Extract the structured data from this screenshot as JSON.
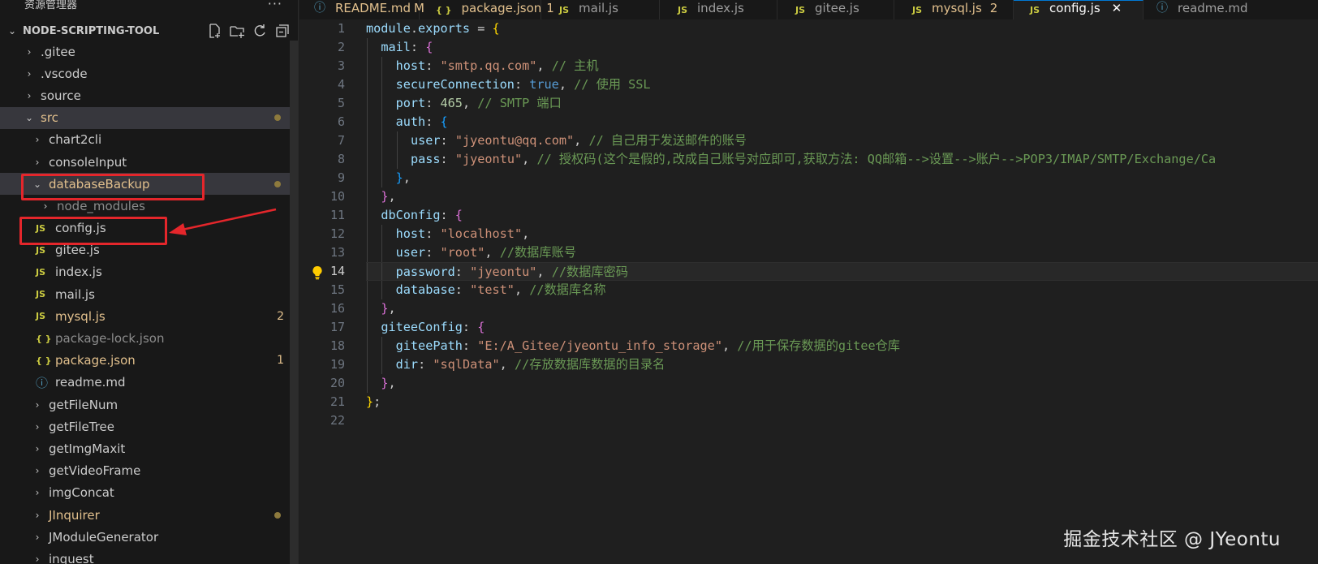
{
  "sidebar": {
    "title": "资源管理器",
    "more": "···",
    "project": "NODE-SCRIPTING-TOOL",
    "items": [
      {
        "label": ".gitee",
        "kind": "folder",
        "depth": 0
      },
      {
        "label": ".vscode",
        "kind": "folder",
        "depth": 0
      },
      {
        "label": "source",
        "kind": "folder",
        "depth": 0
      },
      {
        "label": "src",
        "kind": "folder-open",
        "depth": 0,
        "modified": true
      },
      {
        "label": "chart2cli",
        "kind": "folder",
        "depth": 1
      },
      {
        "label": "consoleInput",
        "kind": "folder",
        "depth": 1
      },
      {
        "label": "databaseBackup",
        "kind": "folder-open",
        "depth": 1,
        "modified": true
      },
      {
        "label": "node_modules",
        "kind": "folder",
        "depth": 2,
        "dim": true
      },
      {
        "label": "config.js",
        "kind": "js",
        "depth": 2
      },
      {
        "label": "gitee.js",
        "kind": "js",
        "depth": 2
      },
      {
        "label": "index.js",
        "kind": "js",
        "depth": 2
      },
      {
        "label": "mail.js",
        "kind": "js",
        "depth": 2
      },
      {
        "label": "mysql.js",
        "kind": "js",
        "depth": 2,
        "badge": "2"
      },
      {
        "label": "package-lock.json",
        "kind": "json",
        "depth": 2,
        "dim": true
      },
      {
        "label": "package.json",
        "kind": "json",
        "depth": 2,
        "badge": "1"
      },
      {
        "label": "readme.md",
        "kind": "info",
        "depth": 2
      },
      {
        "label": "getFileNum",
        "kind": "folder",
        "depth": 1
      },
      {
        "label": "getFileTree",
        "kind": "folder",
        "depth": 1
      },
      {
        "label": "getImgMaxit",
        "kind": "folder",
        "depth": 1
      },
      {
        "label": "getVideoFrame",
        "kind": "folder",
        "depth": 1
      },
      {
        "label": "imgConcat",
        "kind": "folder",
        "depth": 1
      },
      {
        "label": "JInquirer",
        "kind": "folder",
        "depth": 1,
        "modified": true
      },
      {
        "label": "JModuleGenerator",
        "kind": "folder",
        "depth": 1
      },
      {
        "label": "inquest",
        "kind": "folder",
        "depth": 1
      }
    ]
  },
  "tabs": [
    {
      "label": "README.md",
      "suffix": "M",
      "icon": "info"
    },
    {
      "label": "package.json",
      "suffix": "1",
      "icon": "json"
    },
    {
      "label": "mail.js",
      "suffix": "",
      "icon": "js"
    },
    {
      "label": "index.js",
      "suffix": "",
      "icon": "js"
    },
    {
      "label": "gitee.js",
      "suffix": "",
      "icon": "js"
    },
    {
      "label": "mysql.js",
      "suffix": "2",
      "icon": "js"
    },
    {
      "label": "config.js",
      "suffix": "",
      "icon": "js",
      "active": true
    },
    {
      "label": "readme.md",
      "suffix": "",
      "icon": "info"
    }
  ],
  "icons": {
    "js": "JS",
    "json": "{ }",
    "info": "ⓘ",
    "close": "✕"
  },
  "editor": {
    "current_line": 14,
    "lines": [
      "module.exports = {",
      "  mail: {",
      "    host: \"smtp.qq.com\", // 主机",
      "    secureConnection: true, // 使用 SSL",
      "    port: 465, // SMTP 端口",
      "    auth: {",
      "      user: \"jyeontu@qq.com\", // 自己用于发送邮件的账号",
      "      pass: \"jyeontu\", // 授权码(这个是假的,改成自己账号对应即可,获取方法: QQ邮箱-->设置-->账户-->POP3/IMAP/SMTP/Exchange/Ca",
      "    },",
      "  },",
      "  dbConfig: {",
      "    host: \"localhost\",",
      "    user: \"root\", //数据库账号",
      "    password: \"jyeontu\", //数据库密码",
      "    database: \"test\", //数据库名称",
      "  },",
      "  giteeConfig: {",
      "    giteePath: \"E:/A_Gitee/jyeontu_info_storage\", //用于保存数据的gitee仓库",
      "    dir: \"sqlData\", //存放数据库数据的目录名",
      "  },",
      "};",
      ""
    ]
  },
  "watermark": "掘金技术社区 @ JYeontu",
  "colors": {
    "highlight": "#e4262b",
    "accent": "#0078d4"
  }
}
